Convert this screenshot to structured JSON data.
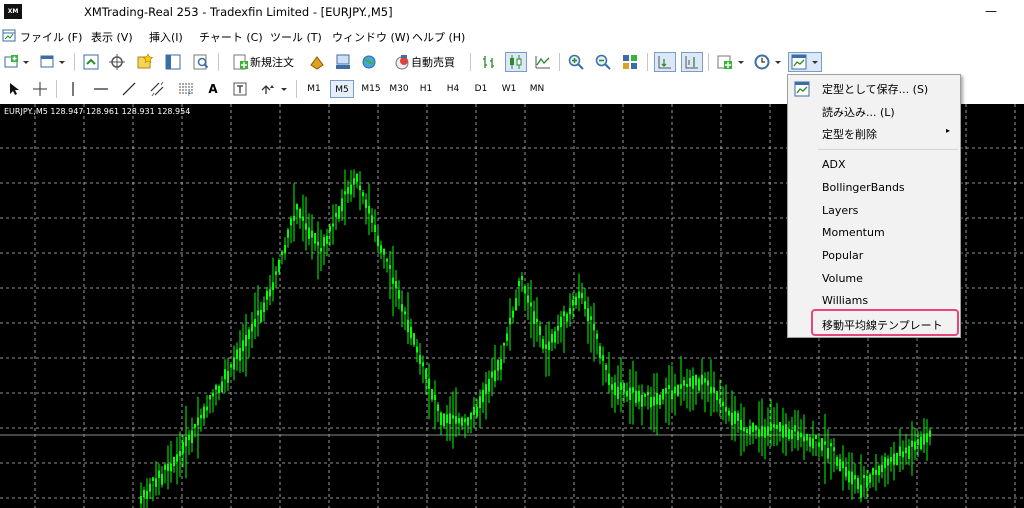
{
  "window": {
    "logo_text": "XM",
    "title": "XMTrading-Real 253 - Tradexfin Limited - [EURJPY.,M5]",
    "minimize_glyph": "—"
  },
  "menu": [
    {
      "label": "ファイル (F)"
    },
    {
      "label": "表示 (V)"
    },
    {
      "label": "挿入(I)"
    },
    {
      "label": "チャート (C)"
    },
    {
      "label": "ツール (T)"
    },
    {
      "label": "ウィンドウ (W)"
    },
    {
      "label": "ヘルプ (H)"
    }
  ],
  "toolbar1": {
    "new_order_label": "新規注文",
    "auto_trade_label": "自動売買"
  },
  "toolbar2": {
    "timeframes": [
      "M1",
      "M5",
      "M15",
      "M30",
      "H1",
      "H4",
      "D1",
      "W1",
      "MN"
    ],
    "active_timeframe": "M5",
    "text_tool": "A"
  },
  "chart": {
    "symbol_line": "EURJPY.,M5  128.947 128.961 128.931 128.954",
    "background": "#000000",
    "candle_color": "#00ff00",
    "grid_color": "#c0c0c0"
  },
  "template_menu": {
    "items": [
      {
        "label": "定型として保存... (S)"
      },
      {
        "label": "読み込み... (L)"
      },
      {
        "label": "定型を削除",
        "submenu": "▸"
      },
      {
        "label": "ADX"
      },
      {
        "label": "BollingerBands"
      },
      {
        "label": "Layers"
      },
      {
        "label": "Momentum"
      },
      {
        "label": "Popular"
      },
      {
        "label": "Volume"
      },
      {
        "label": "Williams"
      },
      {
        "label": "移動平均線テンプレート"
      }
    ],
    "highlight_color": "#e8457a"
  }
}
